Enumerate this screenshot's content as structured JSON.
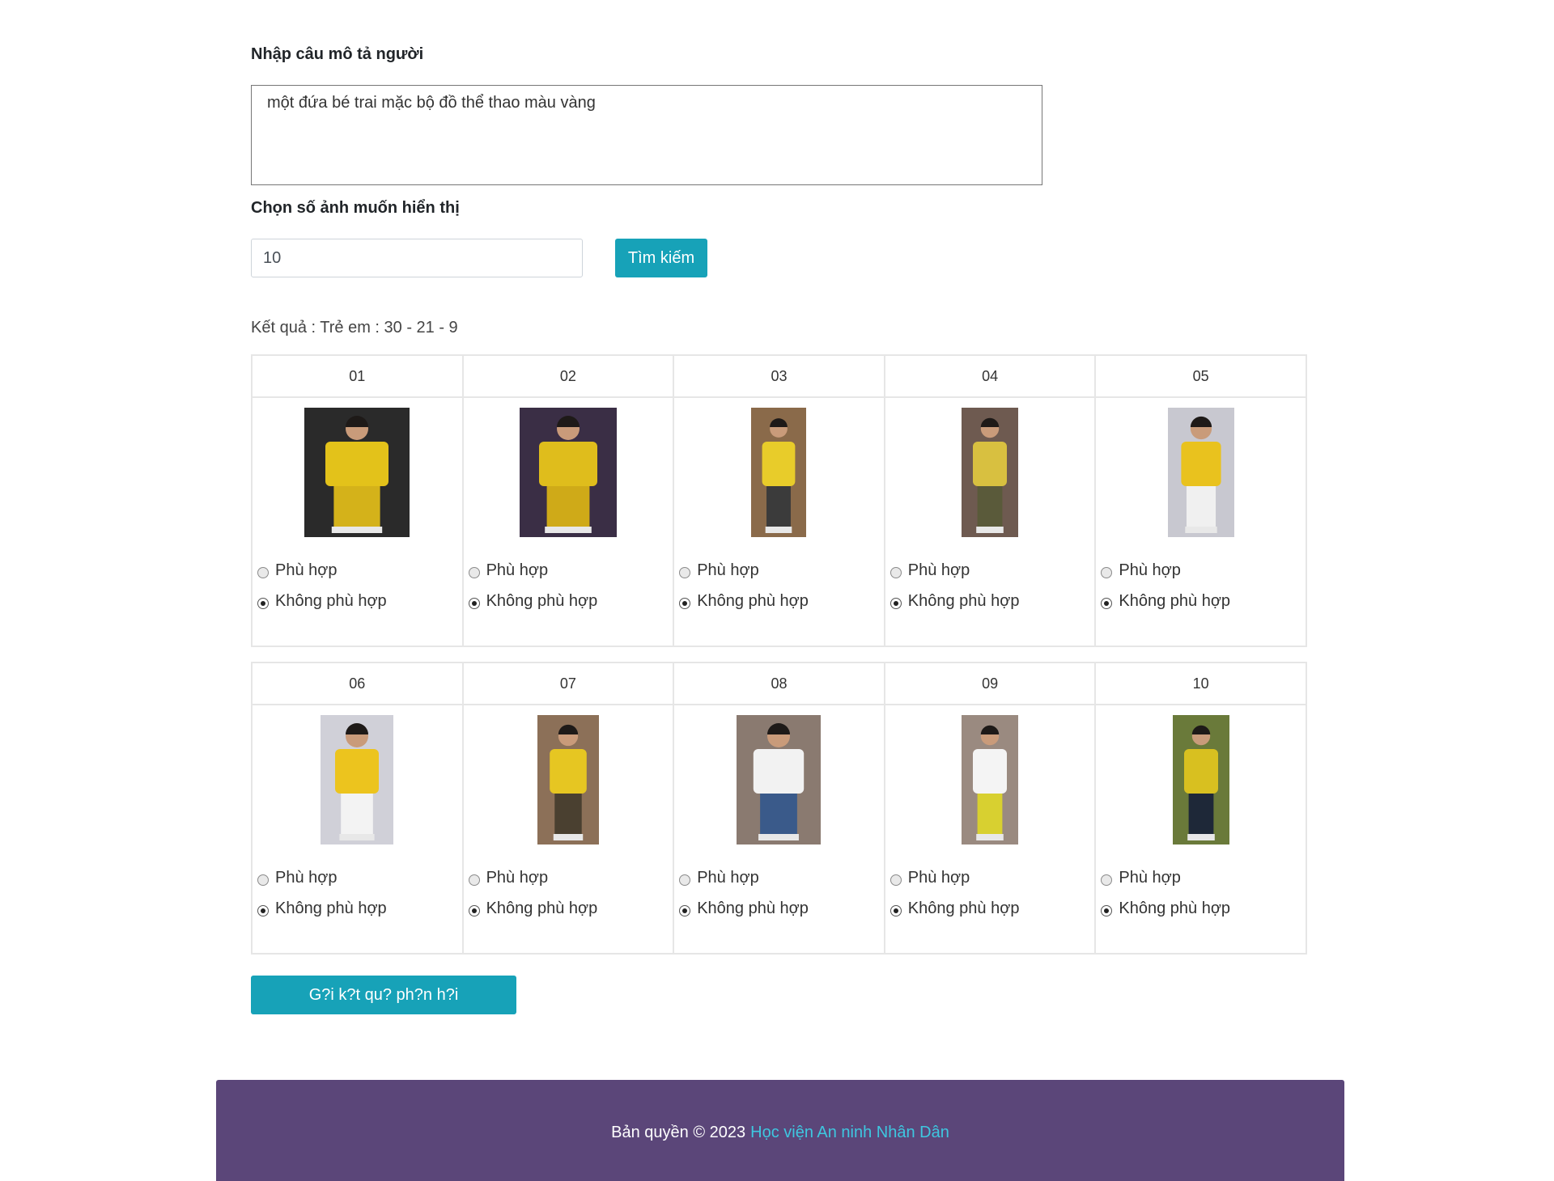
{
  "form": {
    "description_label": "Nhập câu mô tả người",
    "description_value": "một đứa bé trai mặc bộ đồ thể thao màu vàng",
    "count_label": "Chọn số ảnh muốn hiển thị",
    "count_value": "10",
    "search_button": "Tìm kiếm"
  },
  "results": {
    "summary": "Kết quả : Trẻ em : 30 - 21 - 9",
    "option_match": "Phù hợp",
    "option_no_match": "Không phù hợp",
    "items": [
      {
        "id": "01",
        "selected": "no_match",
        "shirt": "#e3c21a",
        "pants": "#d4b21a",
        "bg": "#2a2a2a"
      },
      {
        "id": "02",
        "selected": "no_match",
        "shirt": "#dfbd1c",
        "pants": "#cfaa18",
        "bg": "#3a2e45"
      },
      {
        "id": "03",
        "selected": "no_match",
        "shirt": "#e8cc2a",
        "pants": "#3b3b3b",
        "bg": "#8a6a4a"
      },
      {
        "id": "04",
        "selected": "no_match",
        "shirt": "#d8c040",
        "pants": "#5a5a3a",
        "bg": "#6e5a50"
      },
      {
        "id": "05",
        "selected": "no_match",
        "shirt": "#e9c21e",
        "pants": "#f0f0f0",
        "bg": "#c8c8d0"
      },
      {
        "id": "06",
        "selected": "no_match",
        "shirt": "#ecc41e",
        "pants": "#f3f3f3",
        "bg": "#d0d0d8"
      },
      {
        "id": "07",
        "selected": "no_match",
        "shirt": "#e6c622",
        "pants": "#4a4030",
        "bg": "#8c7058"
      },
      {
        "id": "08",
        "selected": "no_match",
        "shirt": "#f2f2f2",
        "pants": "#3a5a8a",
        "bg": "#8a7a70"
      },
      {
        "id": "09",
        "selected": "no_match",
        "shirt": "#f4f4f4",
        "pants": "#d8d030",
        "bg": "#9a8a80"
      },
      {
        "id": "10",
        "selected": "no_match",
        "shirt": "#d8c020",
        "pants": "#1e2838",
        "bg": "#6a7a3a"
      }
    ]
  },
  "submit_button": "G?i k?t qu? ph?n h?i",
  "footer": {
    "copyright": "Bản quyền © 2023",
    "link_text": "Học viện An ninh Nhân Dân",
    "background": "#5b4679",
    "link_color": "#3ec7e0"
  },
  "accent": "#17a2b8"
}
